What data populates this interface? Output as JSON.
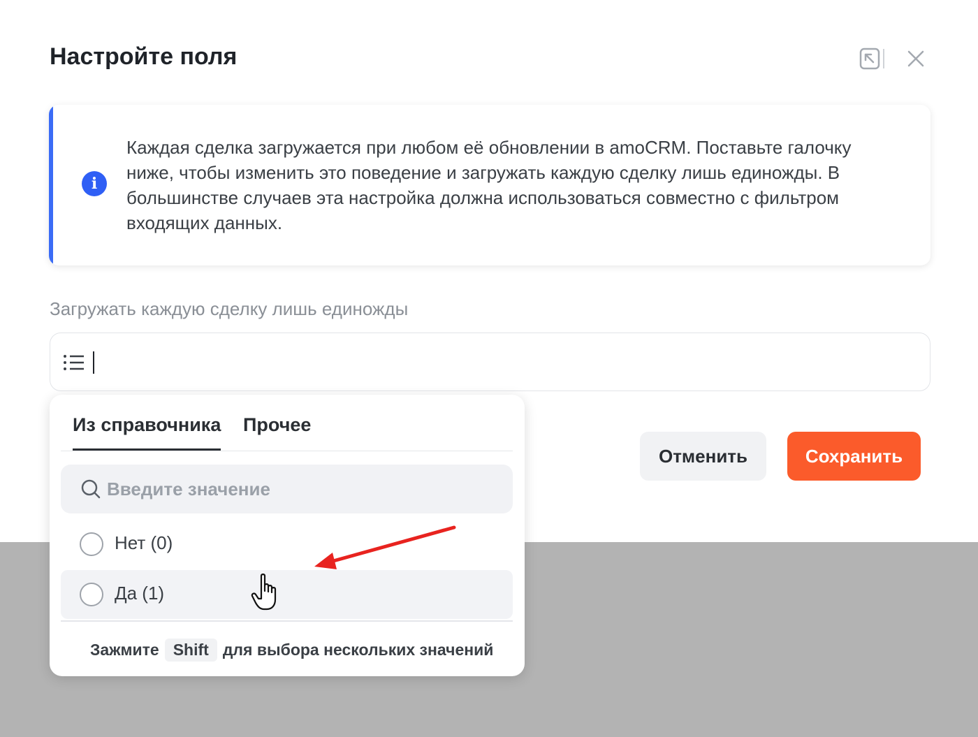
{
  "modal": {
    "title": "Настройте поля"
  },
  "info": {
    "text": "Каждая сделка загружается при любом её обновлении в amoCRM. Поставьте галочку ниже, чтобы изменить это поведение и загружать каждую сделку лишь единожды. В большинстве случаев эта настройка должна использоваться совместно с фильтром входящих данных.",
    "icon": "info-icon",
    "accent_color": "#3b6cf6"
  },
  "field": {
    "label": "Загружать каждую сделку лишь единожды",
    "value": "",
    "icon": "list-icon"
  },
  "dropdown": {
    "tabs": [
      {
        "label": "Из справочника",
        "active": true
      },
      {
        "label": "Прочее",
        "active": false
      }
    ],
    "search": {
      "placeholder": "Введите значение",
      "value": ""
    },
    "options": [
      {
        "label": "Нет (0)",
        "selected": false
      },
      {
        "label": "Да (1)",
        "selected": false
      }
    ],
    "hint": {
      "prefix": "Зажмите",
      "key": "Shift",
      "suffix": "для выбора нескольких значений"
    }
  },
  "actions": {
    "cancel_label": "Отменить",
    "save_label": "Сохранить",
    "save_color": "#fb5b2b"
  }
}
